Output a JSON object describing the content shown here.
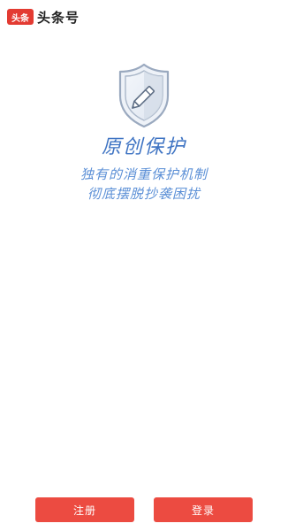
{
  "header": {
    "logo_text": "头条",
    "brand_name": "头条号"
  },
  "hero": {
    "icon": "shield-pencil-icon",
    "title": "原创保护",
    "subtitle_line1": "独有的消重保护机制",
    "subtitle_line2": "彻底摆脱抄袭困扰"
  },
  "actions": {
    "register_label": "注册",
    "login_label": "登录"
  },
  "colors": {
    "brand_red": "#e33b32",
    "button_red": "#ec4b41",
    "title_blue": "#3f74c3",
    "subtitle_blue": "#5b8fd6"
  }
}
